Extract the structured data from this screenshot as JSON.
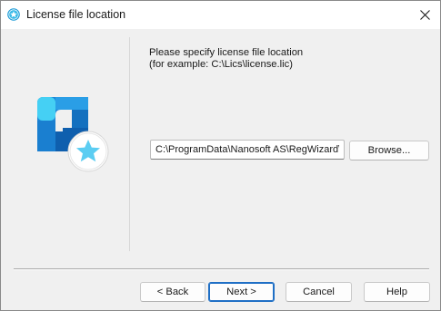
{
  "window": {
    "title": "License file location",
    "icon": "star-badge-icon",
    "close_icon": "close-icon"
  },
  "content": {
    "prompt_line1": "Please specify license file location",
    "prompt_line2": "(for example: C:\\Lics\\license.lic)",
    "path_value": "C:\\ProgramData\\Nanosoft AS\\RegWizard\\License",
    "browse_label": "Browse..."
  },
  "footer": {
    "back_label": "< Back",
    "next_label": "Next >",
    "cancel_label": "Cancel",
    "help_label": "Help"
  },
  "colors": {
    "accent": "#1f6fc5",
    "logo_primary": "#1478c8",
    "logo_light": "#35c2f0",
    "star": "#5bcdf2"
  }
}
